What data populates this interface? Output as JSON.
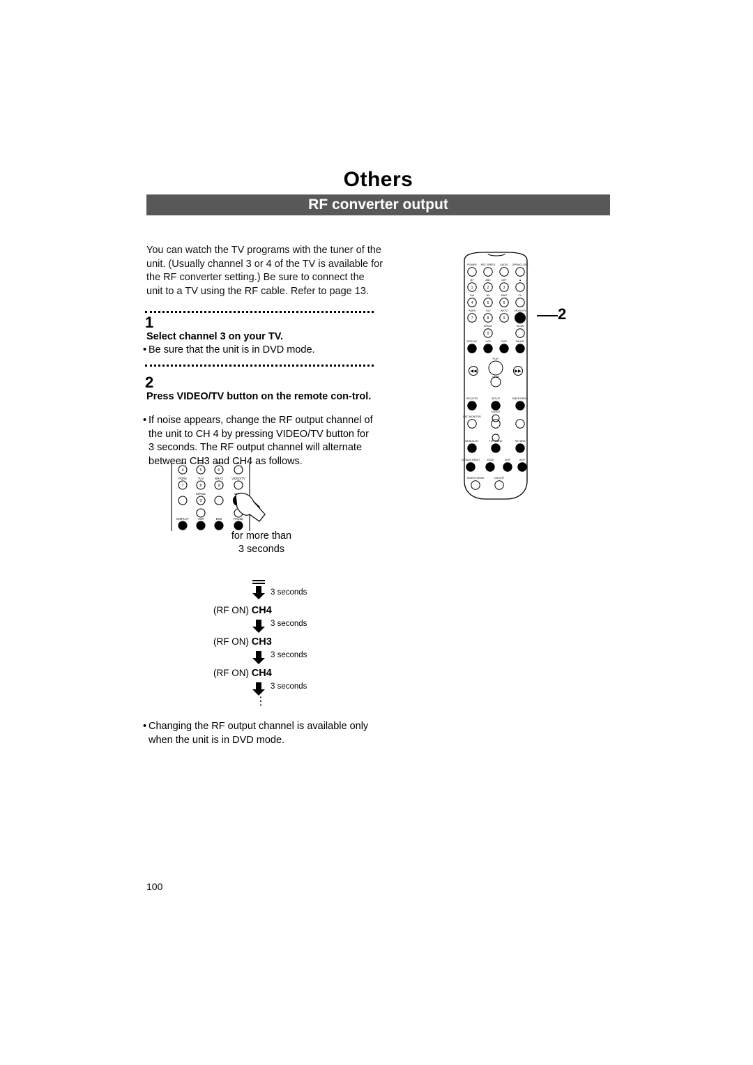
{
  "header": {
    "section_title": "Others",
    "page_title": "RF converter output"
  },
  "intro": "You can watch the TV programs with the tuner of the unit. (Usually channel 3 or 4 of the TV is available for the RF converter setting.) Be sure to connect the unit to a TV using the RF cable. Refer to page 13.",
  "steps": [
    {
      "number": "1",
      "heading": "Select channel 3 on your TV.",
      "bullets": [
        "Be sure that the unit is in DVD mode."
      ]
    },
    {
      "number": "2",
      "heading": "Press VIDEO/TV button on the remote con-trol.",
      "bullets": [
        "If noise appears, change the RF output channel of the unit to CH 4 by pressing VIDEO/TV button for 3 seconds. The RF output channel will alternate between CH3 and CH4 as follows."
      ]
    }
  ],
  "hold_note": {
    "line1": "for more than",
    "line2": "3 seconds"
  },
  "cycle": {
    "duration_label": "3 seconds",
    "states": [
      {
        "prefix": "(RF ON)",
        "channel": "CH4"
      },
      {
        "prefix": "(RF ON)",
        "channel": "CH3"
      },
      {
        "prefix": "(RF ON)",
        "channel": "CH4"
      }
    ],
    "continues": "⋮"
  },
  "final_note": "Changing the RF output channel is available only when the unit is in DVD mode.",
  "callout": {
    "label": "2"
  },
  "page_number": "100",
  "remote": {
    "name": "remote-control-illustration",
    "rows": [
      {
        "labels": [
          "POWER",
          "REC SPEED",
          "AUDIO",
          "OPEN/CLOSE"
        ]
      },
      {
        "labels": [
          "@?",
          "ABC",
          "DEF",
          "▲"
        ]
      },
      {
        "labels": [
          "GHI",
          "JKL",
          "MNO",
          "CH"
        ]
      },
      {
        "labels": [
          "PQRS",
          "TUV",
          "WXYZ",
          "VIDEO/TV"
        ]
      },
      {
        "labels": [
          "SPACE",
          "SLOW"
        ]
      },
      {
        "labels": [
          "DISPLAY",
          "VCR",
          "DVD",
          "PAUSE"
        ]
      },
      {
        "labels": [
          "PLAY",
          "STOP"
        ]
      },
      {
        "labels": [
          "REC/OTR",
          "SETUP",
          "TIMER PROG."
        ]
      },
      {
        "labels": [
          "REC MONITOR",
          "ENTER"
        ]
      },
      {
        "labels": [
          "MENU/LIST",
          "TOP MENU",
          "RETURN"
        ]
      },
      {
        "labels": [
          "CLEAR/C.RESET",
          "ZOOM",
          "SKIP",
          "SKIP"
        ]
      },
      {
        "labels": [
          "SEARCH MODE",
          "CM SKIP"
        ]
      }
    ],
    "keypad_digits": [
      "1",
      "2",
      "3",
      "4",
      "5",
      "6",
      "7",
      "8",
      "9",
      "0"
    ]
  }
}
